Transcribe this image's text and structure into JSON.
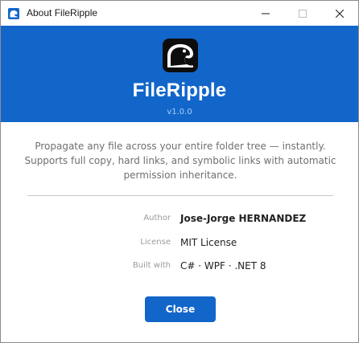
{
  "window": {
    "title": "About FileRipple"
  },
  "header": {
    "app_name": "FileRipple",
    "version": "v1.0.0"
  },
  "description": {
    "line1": "Propagate any file across your entire folder tree — instantly.",
    "line2": "Supports full copy, hard links, and symbolic links with automatic",
    "line3": "permission inheritance."
  },
  "info": [
    {
      "label": "Author",
      "value": "Jose-Jorge HERNANDEZ"
    },
    {
      "label": "License",
      "value": "MIT License"
    },
    {
      "label": "Built with",
      "value": "C# · WPF · .NET 8"
    }
  ],
  "footer": {
    "close_label": "Close"
  },
  "icons": {
    "app": "wave-logo-icon",
    "logo": "wave-logo-icon",
    "minimize": "minimize-icon",
    "maximize": "maximize-icon",
    "close": "close-icon"
  },
  "colors": {
    "accent": "#1266c9",
    "version_text": "#a9cdf6",
    "description_text": "#6f6f6f",
    "label_text": "#9a9a9a"
  }
}
